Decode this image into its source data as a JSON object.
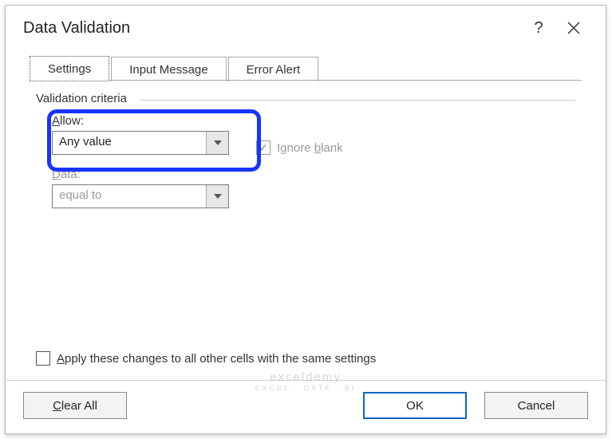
{
  "dialog": {
    "title": "Data Validation",
    "help_tooltip": "?",
    "close_tooltip": "Close"
  },
  "tabs": {
    "settings": "Settings",
    "input_message": "Input Message",
    "error_alert": "Error Alert"
  },
  "criteria": {
    "legend": "Validation criteria",
    "allow_label": "Allow:",
    "allow_value": "Any value",
    "ignore_blank_label": "Ignore blank",
    "data_label": "Data:",
    "data_value": "equal to"
  },
  "apply": {
    "label": "Apply these changes to all other cells with the same settings"
  },
  "buttons": {
    "clear_all": "Clear All",
    "ok": "OK",
    "cancel": "Cancel"
  },
  "watermark": {
    "main": "exceldemy",
    "sub": "EXCEL · DATA · BI"
  }
}
